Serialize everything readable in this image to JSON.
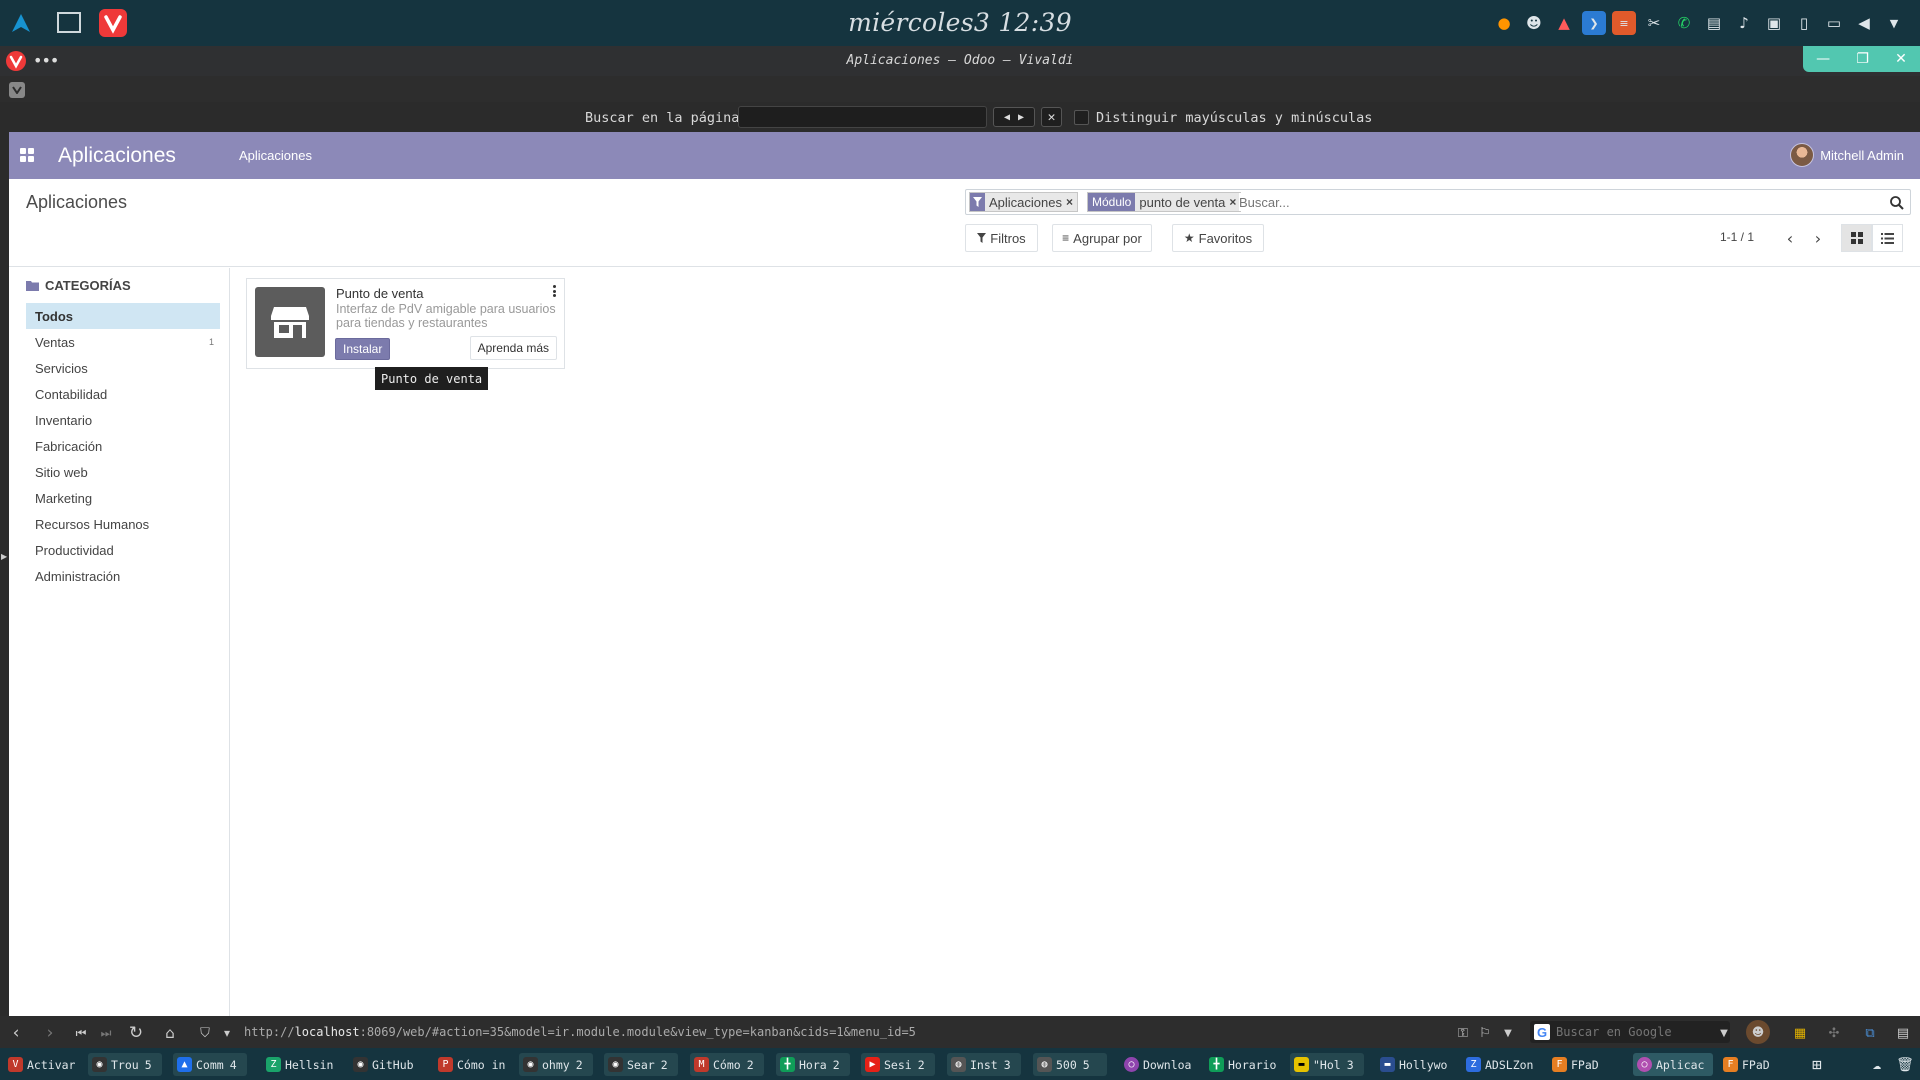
{
  "os": {
    "clock": "miércoles3 12:39",
    "tray_icons": [
      "firefox-icon",
      "discord-icon",
      "ghost-icon",
      "vscode-icon",
      "sublime-icon",
      "network-icon",
      "whatsapp-icon",
      "clipboard-icon",
      "volume-icon",
      "screenshot-icon",
      "battery-icon",
      "display-icon",
      "speaker-icon",
      "menu-icon"
    ]
  },
  "window": {
    "title": "Aplicaciones – Odoo – Vivaldi"
  },
  "find_bar": {
    "label": "Buscar en la página:",
    "value": "",
    "match_case_label": "Distinguir mayúsculas y minúsculas"
  },
  "odoo": {
    "brand": "Aplicaciones",
    "menu_item": "Aplicaciones",
    "user_name": "Mitchell Admin",
    "breadcrumb": "Aplicaciones",
    "facets": [
      {
        "label": "",
        "value": "Aplicaciones"
      },
      {
        "label": "Módulo",
        "value": "punto de venta"
      }
    ],
    "search_placeholder": "Buscar...",
    "filters_label": "Filtros",
    "group_by_label": "Agrupar por",
    "favorites_label": "Favoritos",
    "pager": "1-1 / 1",
    "categories_header": "CATEGORÍAS",
    "categories": [
      {
        "label": "Todos",
        "count": "",
        "active": true
      },
      {
        "label": "Ventas",
        "count": "1",
        "active": false
      },
      {
        "label": "Servicios",
        "count": "",
        "active": false
      },
      {
        "label": "Contabilidad",
        "count": "",
        "active": false
      },
      {
        "label": "Inventario",
        "count": "",
        "active": false
      },
      {
        "label": "Fabricación",
        "count": "",
        "active": false
      },
      {
        "label": "Sitio web",
        "count": "",
        "active": false
      },
      {
        "label": "Marketing",
        "count": "",
        "active": false
      },
      {
        "label": "Recursos Humanos",
        "count": "",
        "active": false
      },
      {
        "label": "Productividad",
        "count": "",
        "active": false
      },
      {
        "label": "Administración",
        "count": "",
        "active": false
      }
    ],
    "card": {
      "title": "Punto de venta",
      "description": "Interfaz de PdV amigable para usuarios para tiendas y restaurantes",
      "install_label": "Instalar",
      "learn_label": "Aprenda más",
      "tooltip": "Punto de venta"
    }
  },
  "address_bar": {
    "url_prefix": "http://",
    "url_host": "localhost",
    "url_rest": ":8069/web/#action=35&model=ir.module.module&view_type=kanban&cids=1&menu_id=5",
    "search_placeholder": "Buscar en Google"
  },
  "taskbar": {
    "items": [
      {
        "label": "Activar",
        "count": "",
        "color": "#c0392b",
        "icon": "vivaldi-icon"
      },
      {
        "label": "Trou",
        "count": "5",
        "color": "#333333",
        "icon": "github-icon"
      },
      {
        "label": "Comm",
        "count": "4",
        "color": "#1f6feb",
        "icon": "arch-icon"
      },
      {
        "label": "Hellsin",
        "count": "",
        "color": "#1aa36a",
        "icon": "hellsing-icon"
      },
      {
        "label": "GitHub",
        "count": "",
        "color": "#333333",
        "icon": "github-icon"
      },
      {
        "label": "Cómo in",
        "count": "",
        "color": "#c0392b",
        "icon": "pdf-icon"
      },
      {
        "label": "ohmy",
        "count": "2",
        "color": "#333333",
        "icon": "github-icon"
      },
      {
        "label": "Sear",
        "count": "2",
        "color": "#333333",
        "icon": "github-icon"
      },
      {
        "label": "Cómo",
        "count": "2",
        "color": "#c0392b",
        "icon": "medium-icon"
      },
      {
        "label": "Hora",
        "count": "2",
        "color": "#0f9d58",
        "icon": "sheets-icon"
      },
      {
        "label": "Sesi",
        "count": "2",
        "color": "#e62117",
        "icon": "youtube-icon"
      },
      {
        "label": "Inst",
        "count": "3",
        "color": "#555555",
        "icon": "globe-icon"
      },
      {
        "label": "500",
        "count": "5",
        "color": "#555555",
        "icon": "globe-icon"
      },
      {
        "label": "Downloa",
        "count": "",
        "color": "#8e44ad",
        "icon": "download-icon"
      },
      {
        "label": "Horario",
        "count": "",
        "color": "#0f9d58",
        "icon": "sheets-icon"
      },
      {
        "label": "\"Hol",
        "count": "3",
        "color": "#e6c200",
        "icon": "imdb-icon"
      },
      {
        "label": "Hollywo",
        "count": "",
        "color": "#2a4d8f",
        "icon": "web-icon"
      },
      {
        "label": "ADSLZon",
        "count": "",
        "color": "#2d6cdf",
        "icon": "adsl-icon"
      },
      {
        "label": "FPaD",
        "count": "",
        "color": "#e67e22",
        "icon": "fpad-icon"
      },
      {
        "label": "Aplicac",
        "count": "",
        "color": "#b04fb0",
        "icon": "odoo-icon"
      },
      {
        "label": "FPaD",
        "count": "",
        "color": "#e67e22",
        "icon": "fpad-icon"
      }
    ]
  },
  "colors": {
    "os_bar": "#15343f",
    "odoo_primary": "#8c89b8",
    "odoo_button": "#7c7bad",
    "active_category": "#d0e6f3",
    "window_controls": "#52c7b0"
  }
}
